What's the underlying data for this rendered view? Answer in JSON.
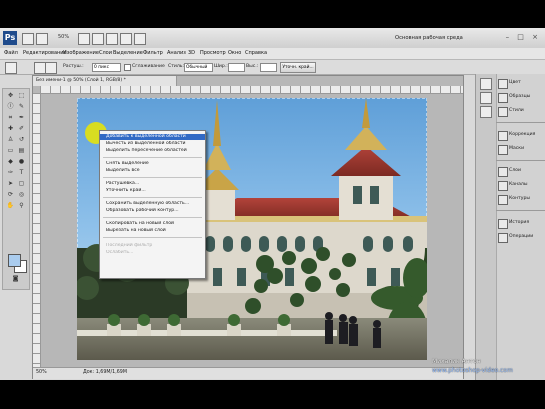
{
  "app": {
    "zoom": "50%",
    "workspace": "Основная рабочая среда",
    "window_controls": "– □ ×"
  },
  "menu": [
    "Файл",
    "Редактирование",
    "Изображение",
    "Слои",
    "Выделение",
    "Фильтр",
    "Анализ",
    "3D",
    "Просмотр",
    "Окно",
    "Справка"
  ],
  "options": {
    "feather_label": "Растуш.:",
    "feather_value": "0 пикс",
    "antialias_label": "Сглаживание",
    "style_label": "Стиль:",
    "style_value": "Обычный",
    "width_label": "Шир.:",
    "height_label": "Выс.:",
    "refine_button": "Уточн. край..."
  },
  "document": {
    "tab_title": "Без имени-1 @ 50% (Слой 1, RGB/8) *",
    "status_zoom": "50%",
    "status_doc": "Док: 1,69M/1,69M"
  },
  "context_menu": {
    "items": [
      {
        "label": "Добавить к выделенной области",
        "state": "highlighted"
      },
      {
        "label": "Вычесть из выделенной области",
        "state": "normal"
      },
      {
        "label": "Выделить пересечение областей",
        "state": "normal"
      },
      {
        "label": "Снять выделение",
        "state": "normal"
      },
      {
        "label": "Выделить всё",
        "state": "normal"
      },
      {
        "label": "Растушёвка...",
        "state": "normal"
      },
      {
        "label": "Уточнить край...",
        "state": "normal"
      },
      {
        "label": "Сохранить выделенную область...",
        "state": "normal"
      },
      {
        "label": "Образовать рабочий контур...",
        "state": "normal"
      },
      {
        "label": "Скопировать на новый слой",
        "state": "normal"
      },
      {
        "label": "Вырезать на новый слой",
        "state": "normal"
      },
      {
        "label": "Последний фильтр",
        "state": "disabled"
      },
      {
        "label": "Ослабить...",
        "state": "disabled"
      }
    ]
  },
  "panels": [
    "Цвет",
    "Образцы",
    "Стили",
    "Коррекция",
    "Маски",
    "Слои",
    "Каналы",
    "Контуры",
    "История",
    "Операции"
  ],
  "watermark": {
    "author": "Михалик Антон",
    "site": "www.photoshop-video.com"
  },
  "colors": {
    "highlight": "#316ac5",
    "foreground_swatch": "#aaccee",
    "background_swatch": "#ffffff"
  }
}
